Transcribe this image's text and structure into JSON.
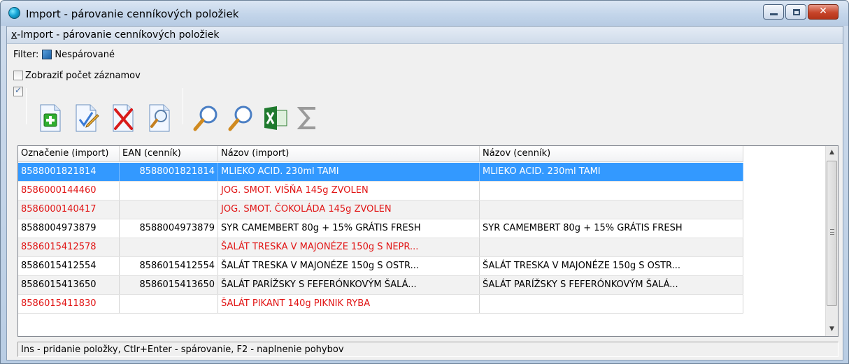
{
  "window": {
    "title": "Import - párovanie cenníkových položiek",
    "controls": {
      "minimize": "minimize",
      "maximize": "maximize",
      "close": "close"
    }
  },
  "menubar": {
    "accel": "x",
    "label": "-Import - párovanie cenníkových položiek"
  },
  "filter": {
    "label": "Filter:",
    "value": "Nespárované"
  },
  "show_count": {
    "label": "Zobraziť počet záznamov",
    "checked": false
  },
  "toolbar": {
    "select_all_checked": true,
    "buttons": [
      {
        "name": "add-icon"
      },
      {
        "name": "edit-check-icon"
      },
      {
        "name": "delete-icon"
      },
      {
        "name": "preview-icon"
      },
      {
        "name": "search-icon"
      },
      {
        "name": "search-next-icon"
      },
      {
        "name": "excel-icon"
      },
      {
        "name": "sum-icon"
      }
    ]
  },
  "grid": {
    "columns": [
      "Označenie (import)",
      "EAN (cenník)",
      "Názov (import)",
      "Názov (cenník)"
    ],
    "rows": [
      {
        "code": "8588001821814",
        "ean": "8588001821814",
        "name_import": "MLIEKO ACID. 230ml TAMI",
        "name_price": "MLIEKO ACID. 230ml TAMI",
        "paired": true,
        "selected": true
      },
      {
        "code": "8586000144460",
        "ean": "",
        "name_import": "JOG. SMOT. VIŠŇA 145g ZVOLEN",
        "name_price": "",
        "paired": false
      },
      {
        "code": "8586000140417",
        "ean": "",
        "name_import": "JOG. SMOT. ČOKOLÁDA 145g ZVOLEN",
        "name_price": "",
        "paired": false
      },
      {
        "code": "8588004973879",
        "ean": "8588004973879",
        "name_import": "SYR CAMEMBERT 80g + 15% GRÁTIS FRESH",
        "name_price": "SYR CAMEMBERT 80g + 15% GRÁTIS FRESH",
        "paired": true
      },
      {
        "code": "8586015412578",
        "ean": "",
        "name_import": "ŠALÁT TRESKA V MAJONÉZE 150g S NEPR...",
        "name_price": "",
        "paired": false
      },
      {
        "code": "8586015412554",
        "ean": "8586015412554",
        "name_import": "ŠALÁT TRESKA V MAJONÉZE 150g S OSTR...",
        "name_price": "ŠALÁT TRESKA V MAJONÉZE 150g S OSTR...",
        "paired": true
      },
      {
        "code": "8586015413650",
        "ean": "8586015413650",
        "name_import": "ŠALÁT PARÍŽSKY S FEFERÓNKOVÝM ŠALÁ...",
        "name_price": "ŠALÁT PARÍŽSKY S FEFERÓNKOVÝM ŠALÁ...",
        "paired": true
      },
      {
        "code": "8586015411830",
        "ean": "",
        "name_import": "ŠALÁT PIKANT 140g  PIKNIK RYBA",
        "name_price": "",
        "paired": false
      }
    ]
  },
  "statusbar": {
    "text": "Ins - pridanie položky, Ctlr+Enter - spárovanie, F2 - naplnenie pohybov"
  },
  "colors": {
    "unpaired_text": "#e11414",
    "selection": "#3399ff",
    "alt_row": "#f2f2f2"
  }
}
